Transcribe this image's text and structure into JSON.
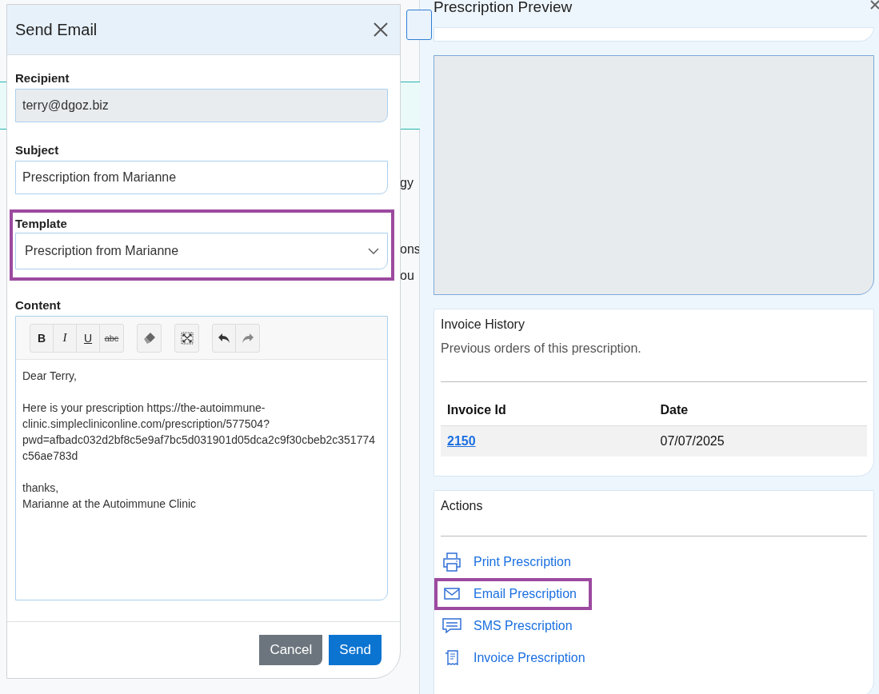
{
  "background_fragments": [
    "gy",
    "ons",
    "ou"
  ],
  "modal": {
    "title": "Send Email",
    "recipient": {
      "label": "Recipient",
      "value": "terry@dgoz.biz",
      "disabled": true
    },
    "subject": {
      "label": "Subject",
      "value": "Prescription from Marianne"
    },
    "template": {
      "label": "Template",
      "value": "Prescription from Marianne",
      "highlighted": true
    },
    "content": {
      "label": "Content",
      "toolbar": [
        [
          {
            "kind": "text",
            "label": "B"
          },
          {
            "kind": "text",
            "label": "I"
          },
          {
            "kind": "text",
            "label": "U"
          },
          {
            "kind": "text",
            "label": "abc"
          }
        ],
        [
          {
            "kind": "eraser"
          }
        ],
        [
          {
            "kind": "fullscreen"
          }
        ],
        [
          {
            "kind": "undo"
          },
          {
            "kind": "redo"
          }
        ]
      ],
      "paragraphs": [
        [
          "Dear Terry,"
        ],
        [
          "Here is your prescription https://the-autoimmune-clinic.simplecliniconline.com/prescription/577504?pwd=afbadc032d2bf8c5e9af7bc5d031901d05dca2c9f30cbeb2c351774c56ae783d"
        ],
        [
          "thanks,",
          "Marianne at the Autoimmune Clinic"
        ]
      ]
    },
    "buttons": [
      {
        "label": "Cancel",
        "kind": "secondary"
      },
      {
        "label": "Send",
        "kind": "primary"
      }
    ]
  },
  "panel": {
    "title": "Prescription Preview",
    "invoice_history": {
      "title": "Invoice History",
      "description": "Previous orders of this prescription.",
      "columns": [
        "Invoice Id",
        "Date"
      ],
      "rows": [
        {
          "invoice_id": "2150",
          "date": "07/07/2025"
        }
      ]
    },
    "actions": {
      "title": "Actions",
      "items": [
        {
          "label": "Print Prescription",
          "kind": "print",
          "highlighted": false
        },
        {
          "label": "Email Prescription",
          "kind": "email",
          "highlighted": true
        },
        {
          "label": "SMS Prescription",
          "kind": "sms",
          "highlighted": false
        },
        {
          "label": "Invoice Prescription",
          "kind": "invoice",
          "highlighted": false
        }
      ]
    }
  }
}
